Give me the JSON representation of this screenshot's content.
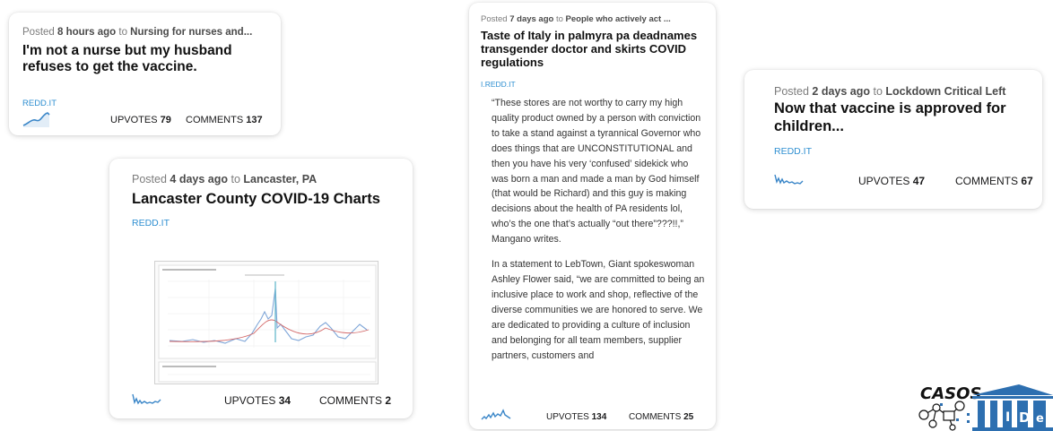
{
  "posts": [
    {
      "posted_prefix": "Posted ",
      "age": "8 hours ago",
      "to_text": " to ",
      "community": "Nursing for nurses and...",
      "title": "I'm not a nurse but my husband refuses to get the vaccine.",
      "domain": "REDD.IT",
      "upvotes_label": "UPVOTES",
      "upvotes": "79",
      "comments_label": "COMMENTS",
      "comments": "137"
    },
    {
      "posted_prefix": "Posted ",
      "age": "4 days ago",
      "to_text": " to ",
      "community": "Lancaster, PA",
      "title": "Lancaster County COVID-19 Charts",
      "domain": "REDD.IT",
      "upvotes_label": "UPVOTES",
      "upvotes": "34",
      "comments_label": "COMMENTS",
      "comments": "2"
    },
    {
      "posted_prefix": "Posted ",
      "age": "7 days ago",
      "to_text": " to ",
      "community": "People who actively act ...",
      "title": "Taste of Italy in palmyra pa deadnames transgender doctor and skirts COVID regulations",
      "domain": "I.REDD.IT",
      "body_p1": "“These stores are not worthy to carry my high quality product owned by a person with conviction to take a stand against a tyrannical Governor who does things that are UNCONSTITUTIONAL and then you have his very ‘confused’ sidekick who was born a man and made a man by God himself (that would be Richard) and this guy is making decisions about the health of PA residents lol, who’s the one that’s actually “out there”???!!,” Mangano writes.",
      "body_p2": "In a statement to LebTown, Giant spokeswoman Ashley Flower said, “we are committed to being an inclusive place to work and shop, reflective of the diverse communities we are honored to serve. We are dedicated to providing a culture of inclusion and belonging for all team members, supplier partners, customers and",
      "upvotes_label": "UPVOTES",
      "upvotes": "134",
      "comments_label": "COMMENTS",
      "comments": "25"
    },
    {
      "posted_prefix": "Posted ",
      "age": "2 days ago",
      "to_text": " to ",
      "community": "Lockdown Critical Left",
      "title": "Now that vaccine is approved for children...",
      "domain": "REDD.IT",
      "upvotes_label": "UPVOTES",
      "upvotes": "47",
      "comments_label": "COMMENTS",
      "comments": "67"
    }
  ],
  "logo": {
    "text": "CASOS",
    "icon": "casos-ide-logo"
  },
  "colors": {
    "domain": "#2f8fd1",
    "sparkline": "#3a86c8",
    "logo_blue": "#2d6fb0"
  }
}
